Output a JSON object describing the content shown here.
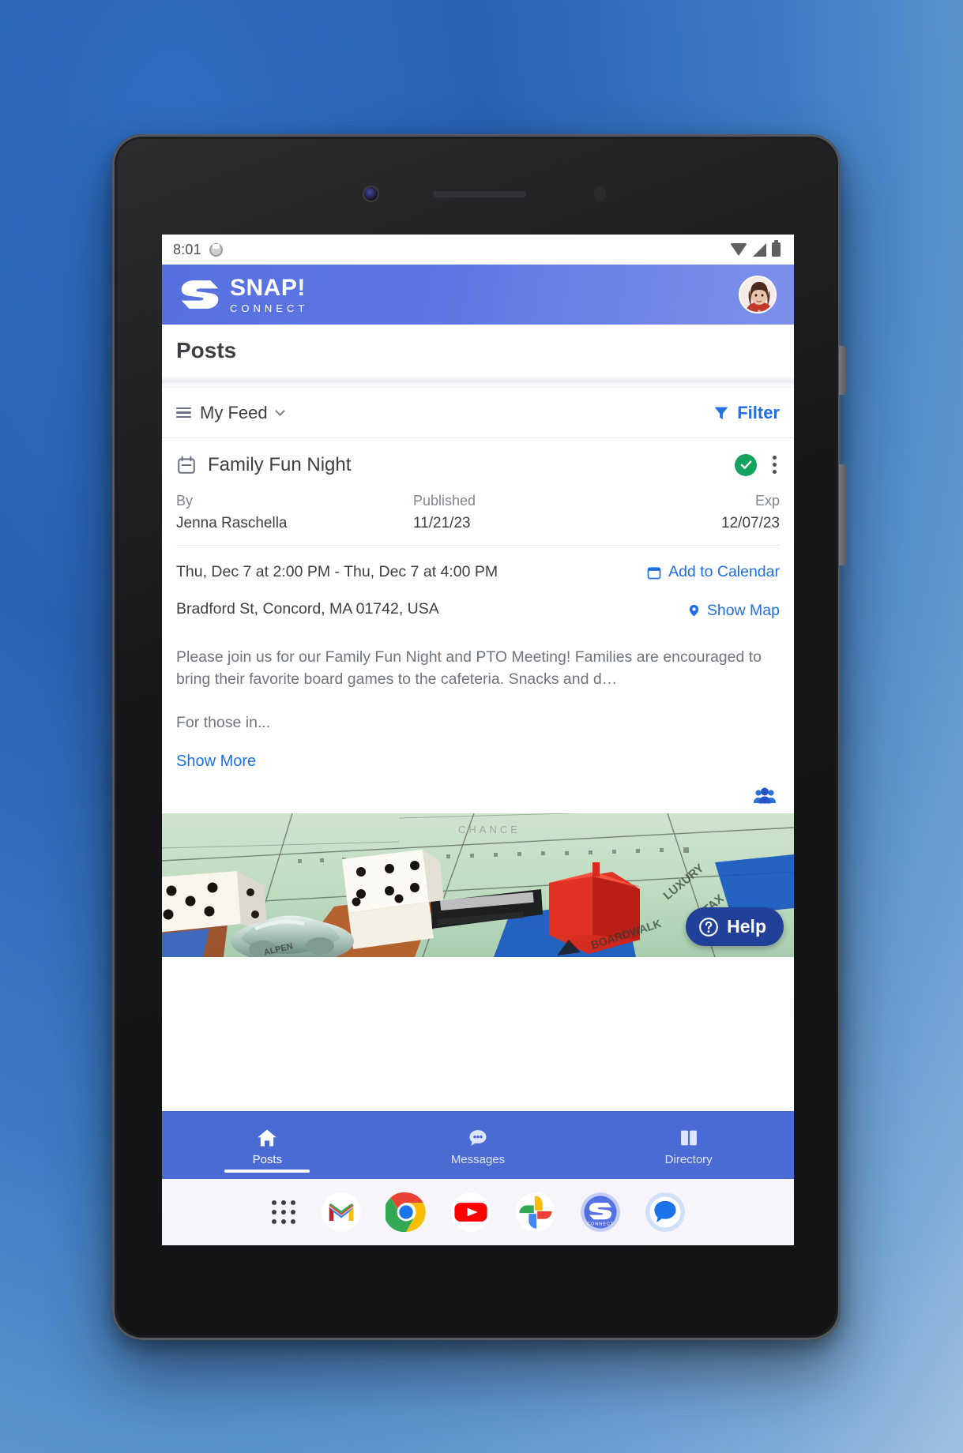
{
  "status_bar": {
    "time": "8:01",
    "notification_icon": "app-notification-icon",
    "wifi_icon": "wifi-icon",
    "signal_icon": "cell-signal-icon",
    "battery_icon": "battery-icon"
  },
  "app_bar": {
    "brand_title": "SNAP!",
    "brand_subtitle": "CONNECT",
    "logo_icon": "snap-s-logo-icon",
    "avatar": "user-profile-avatar"
  },
  "page": {
    "title": "Posts"
  },
  "feed_toolbar": {
    "menu_icon": "hamburger-icon",
    "feed_label": "My Feed",
    "chevron_icon": "chevron-down-icon",
    "filter_icon": "filter-funnel-icon",
    "filter_label": "Filter"
  },
  "post": {
    "type_icon": "calendar-event-icon",
    "title": "Family Fun Night",
    "status_icon": "verified-check-icon",
    "overflow_icon": "more-vertical-icon",
    "meta": {
      "author_label": "By",
      "author_value": "Jenna Raschella",
      "published_label": "Published",
      "published_value": "11/21/23",
      "expires_label": "Exp",
      "expires_value": "12/07/23"
    },
    "event": {
      "datetime": "Thu, Dec 7 at 2:00 PM - Thu, Dec 7 at 4:00 PM",
      "add_to_calendar_icon": "calendar-add-icon",
      "add_to_calendar_label": "Add to Calendar",
      "location": "Bradford St, Concord, MA 01742, USA",
      "show_map_icon": "map-pin-icon",
      "show_map_label": "Show Map"
    },
    "body_text": "Please join us for our Family Fun Night and PTO Meeting! Families are encouraged to bring their favorite board games to the cafeteria. Snacks and d…",
    "body_continuation": "For those in...",
    "show_more_label": "Show More",
    "audience_icon": "group-people-icon",
    "media_alt": "monopoly-board-game-photo"
  },
  "help_fab": {
    "icon": "question-circle-icon",
    "label": "Help"
  },
  "bottom_nav": {
    "items": [
      {
        "label": "Posts",
        "icon": "home-icon",
        "active": true
      },
      {
        "label": "Messages",
        "icon": "chat-bubble-icon",
        "active": false
      },
      {
        "label": "Directory",
        "icon": "book-open-icon",
        "active": false
      }
    ]
  },
  "android_dock": {
    "apps": [
      {
        "name": "app-drawer"
      },
      {
        "name": "gmail"
      },
      {
        "name": "chrome"
      },
      {
        "name": "youtube"
      },
      {
        "name": "google-photos"
      },
      {
        "name": "snap-connect"
      },
      {
        "name": "google-messages"
      }
    ]
  },
  "colors": {
    "brand_blue": "#5570e0",
    "nav_blue": "#4a6ad4",
    "link_blue": "#1f6fe5",
    "verified_green": "#12a45e",
    "help_navy": "#21409a",
    "text_primary": "#3c4043",
    "text_muted": "#80868e",
    "background_blue": "#2f6fc4"
  }
}
